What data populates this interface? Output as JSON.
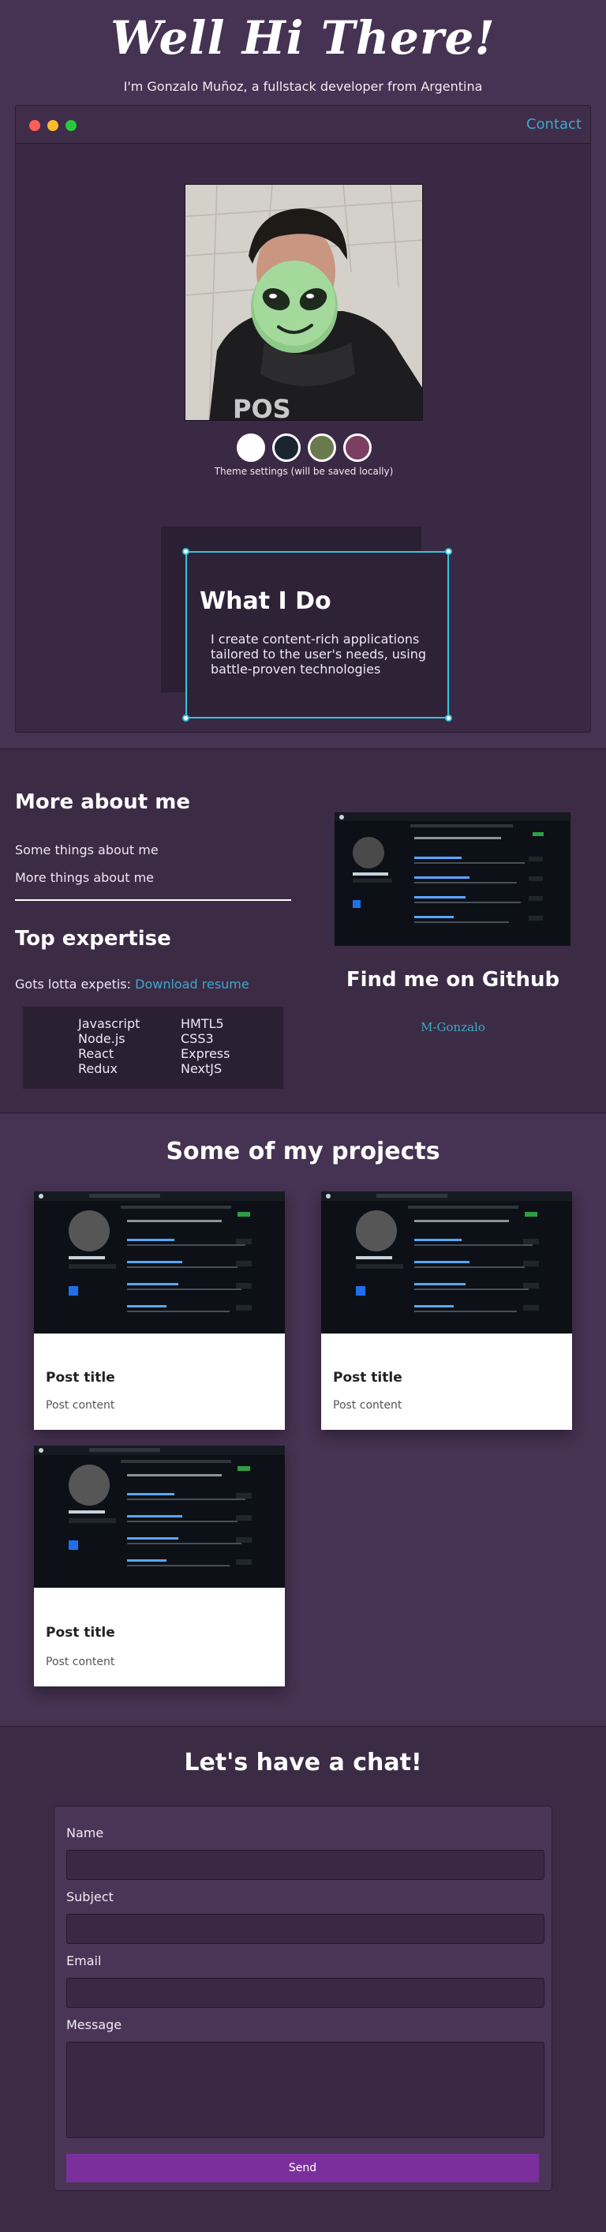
{
  "hero": {
    "greeting": "Well Hi There!",
    "intro": "I'm Gonzalo Muñoz, a fullstack developer from Argentina"
  },
  "window": {
    "contact_label": "Contact",
    "theme_note": "Theme settings (will be saved locally)",
    "theme_swatches": [
      "#ffffff",
      "#1b2431",
      "#6b7a4e",
      "#7a3f63"
    ]
  },
  "what_i_do": {
    "title": "What I Do",
    "text": "I create content-rich applications tailored to the user's needs, using battle-proven technologies"
  },
  "about": {
    "more_title": "More about me",
    "lines": [
      "Some things about me",
      "More things about me"
    ],
    "expertise_title": "Top expertise",
    "expertise_text": "Gots lotta expetis:",
    "resume_link": "Download resume",
    "skills_col1": [
      "Javascript",
      "Node.js",
      "React",
      "Redux"
    ],
    "skills_col2": [
      "HMTL5",
      "CSS3",
      "Express",
      "NextJS"
    ],
    "github_title": "Find me on Github",
    "github_user": "M-Gonzalo"
  },
  "projects": {
    "title": "Some of my projects",
    "cards": [
      {
        "title": "Post title",
        "content": "Post content"
      },
      {
        "title": "Post title",
        "content": "Post content"
      },
      {
        "title": "Post title",
        "content": "Post content"
      }
    ]
  },
  "chat": {
    "title": "Let's have a chat!",
    "name_label": "Name",
    "subject_label": "Subject",
    "email_label": "Email",
    "message_label": "Message",
    "send_label": "Send"
  },
  "colors": {
    "accent": "#3fa9c9",
    "selection": "#35c4dc",
    "send_button": "#7b2f9c"
  }
}
